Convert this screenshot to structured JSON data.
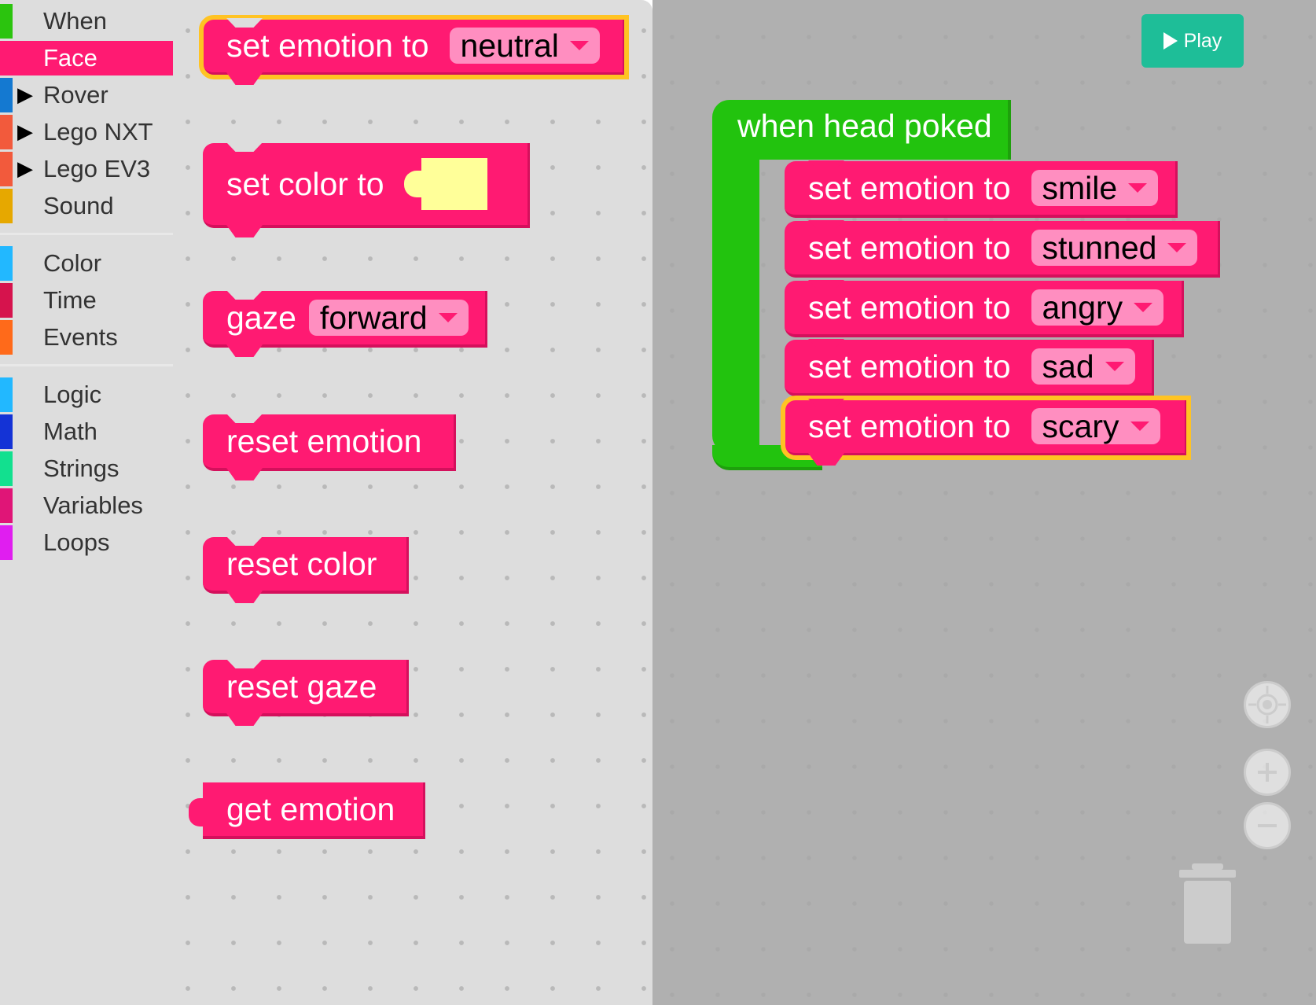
{
  "categories": [
    {
      "label": "When",
      "color": "#2bc40e",
      "expandable": false,
      "selected": false
    },
    {
      "label": "Face",
      "color": "#ff1a72",
      "expandable": false,
      "selected": true
    },
    {
      "label": "Rover",
      "color": "#1479d1",
      "expandable": true,
      "selected": false
    },
    {
      "label": "Lego NXT",
      "color": "#f25a3c",
      "expandable": true,
      "selected": false
    },
    {
      "label": "Lego EV3",
      "color": "#f25a3c",
      "expandable": true,
      "selected": false
    },
    {
      "label": "Sound",
      "color": "#e6a800",
      "expandable": false,
      "selected": false
    },
    {
      "label": "Color",
      "color": "#22b8ff",
      "expandable": false,
      "selected": false
    },
    {
      "label": "Time",
      "color": "#d6134d",
      "expandable": false,
      "selected": false
    },
    {
      "label": "Events",
      "color": "#ff6a1a",
      "expandable": false,
      "selected": false
    },
    {
      "label": "Logic",
      "color": "#22b8ff",
      "expandable": false,
      "selected": false
    },
    {
      "label": "Math",
      "color": "#1433d6",
      "expandable": false,
      "selected": false
    },
    {
      "label": "Strings",
      "color": "#12e08f",
      "expandable": false,
      "selected": false
    },
    {
      "label": "Variables",
      "color": "#e01577",
      "expandable": false,
      "selected": false
    },
    {
      "label": "Loops",
      "color": "#e01ef0",
      "expandable": false,
      "selected": false
    }
  ],
  "flyout": {
    "set_emotion": {
      "label": "set emotion to",
      "value": "neutral"
    },
    "set_color": {
      "label": "set color to",
      "value_color": "#ffff99"
    },
    "gaze": {
      "label": "gaze",
      "value": "forward"
    },
    "reset_emotion": {
      "label": "reset emotion"
    },
    "reset_color": {
      "label": "reset color"
    },
    "reset_gaze": {
      "label": "reset gaze"
    },
    "get_emotion": {
      "label": "get emotion"
    }
  },
  "workspace": {
    "event_label": "when head poked",
    "statements": [
      {
        "label": "set emotion to",
        "value": "smile"
      },
      {
        "label": "set emotion to",
        "value": "stunned"
      },
      {
        "label": "set emotion to",
        "value": "angry"
      },
      {
        "label": "set emotion to",
        "value": "sad"
      },
      {
        "label": "set emotion to",
        "value": "scary"
      }
    ]
  },
  "play_button": {
    "label": "Play"
  },
  "colors": {
    "face": "#ff1a72",
    "when": "#22c30e",
    "play": "#1ebe98",
    "selection": "#ffc323"
  }
}
